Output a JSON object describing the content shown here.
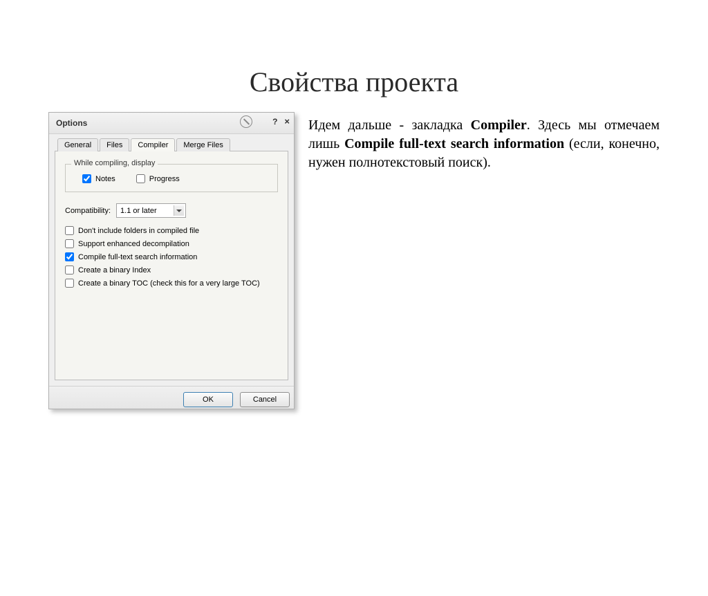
{
  "slide": {
    "title": "Свойства проекта",
    "body_pre": "Идем дальше - закладка ",
    "body_b1": "Compiler",
    "body_mid": ". Здесь мы отмечаем лишь ",
    "body_b2": "Compile full-text search information",
    "body_post": " (если, конечно, нужен полнотекстовый поиск)."
  },
  "dialog": {
    "title": "Options",
    "help": "?",
    "close": "×",
    "tabs": [
      "General",
      "Files",
      "Compiler",
      "Merge Files"
    ],
    "active_tab": 2,
    "group_legend": "While compiling, display",
    "notes_label": "Notes",
    "notes_checked": true,
    "progress_label": "Progress",
    "progress_checked": false,
    "compat_label": "Compatibility:",
    "compat_value": "1.1 or later",
    "opts": [
      {
        "label": "Don't include folders in compiled file",
        "checked": false
      },
      {
        "label": "Support enhanced decompilation",
        "checked": false
      },
      {
        "label": "Compile full-text search information",
        "checked": true
      },
      {
        "label": "Create a binary Index",
        "checked": false
      },
      {
        "label": "Create a binary TOC (check this for a very large TOC)",
        "checked": false
      }
    ],
    "ok": "OK",
    "cancel": "Cancel"
  }
}
